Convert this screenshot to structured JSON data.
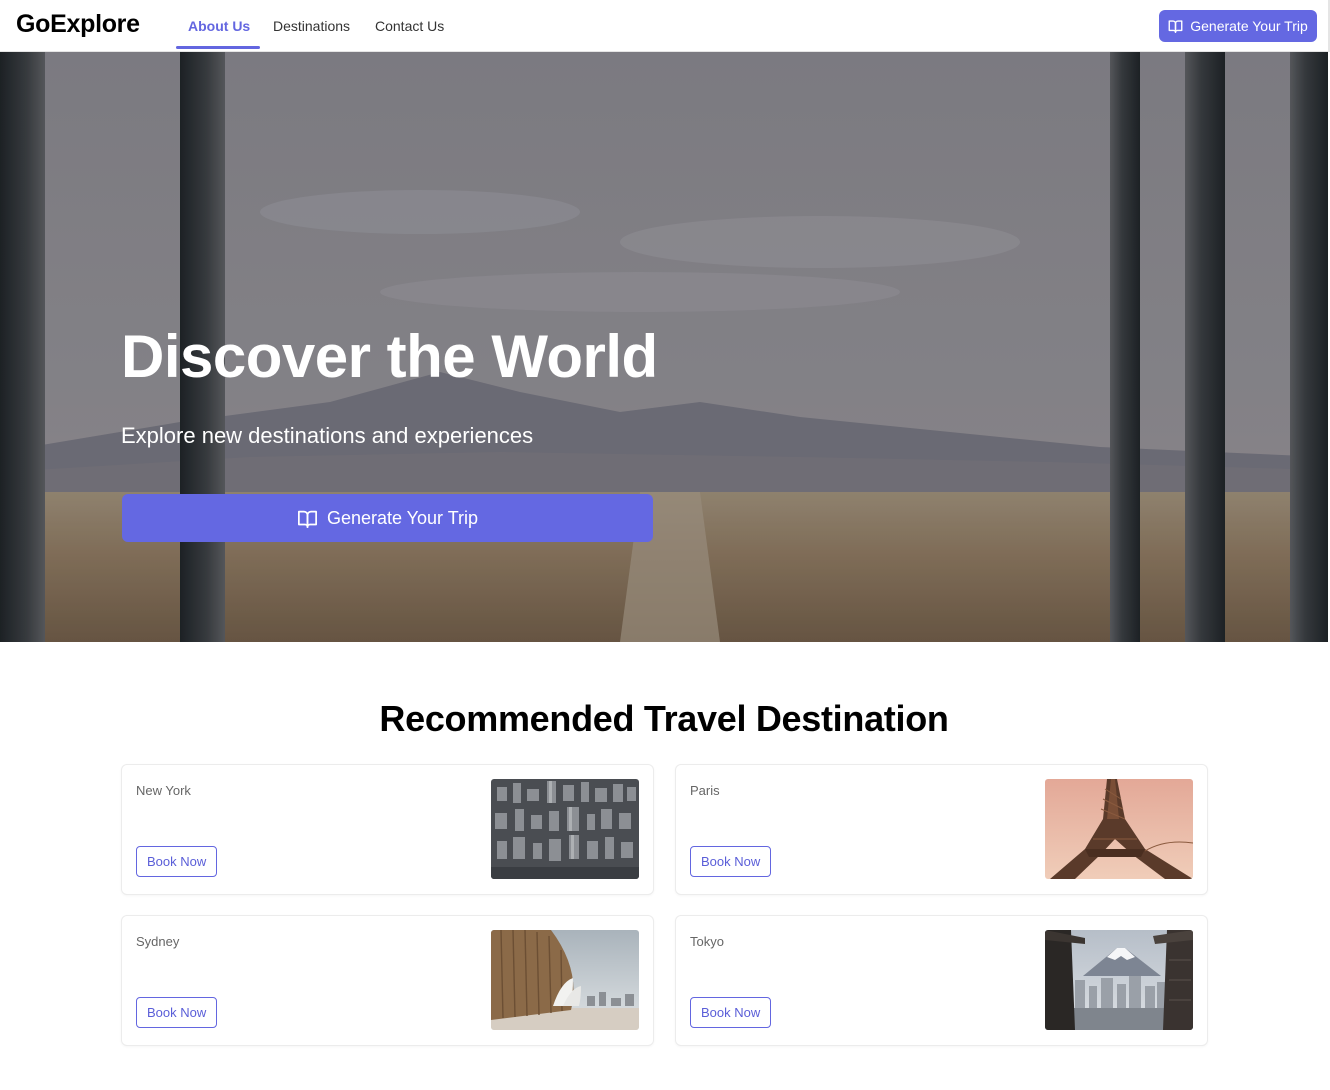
{
  "nav": {
    "brand": "GoExplore",
    "links": [
      {
        "label": "About Us",
        "active": true
      },
      {
        "label": "Destinations",
        "active": false
      },
      {
        "label": "Contact Us",
        "active": false
      }
    ],
    "cta_label": "Generate Your Trip",
    "cta_icon": "book-open-icon"
  },
  "hero": {
    "title": "Discover the World",
    "subtitle": "Explore new destinations and experiences",
    "cta_label": "Generate Your Trip",
    "cta_icon": "book-open-icon"
  },
  "destinations": {
    "title": "Recommended Travel Destination",
    "items": [
      {
        "name": "New York",
        "button": "Book Now"
      },
      {
        "name": "Paris",
        "button": "Book Now"
      },
      {
        "name": "Sydney",
        "button": "Book Now"
      },
      {
        "name": "Tokyo",
        "button": "Book Now"
      }
    ]
  },
  "colors": {
    "accent": "#6468e2",
    "text": "#222222",
    "muted": "#666666"
  }
}
